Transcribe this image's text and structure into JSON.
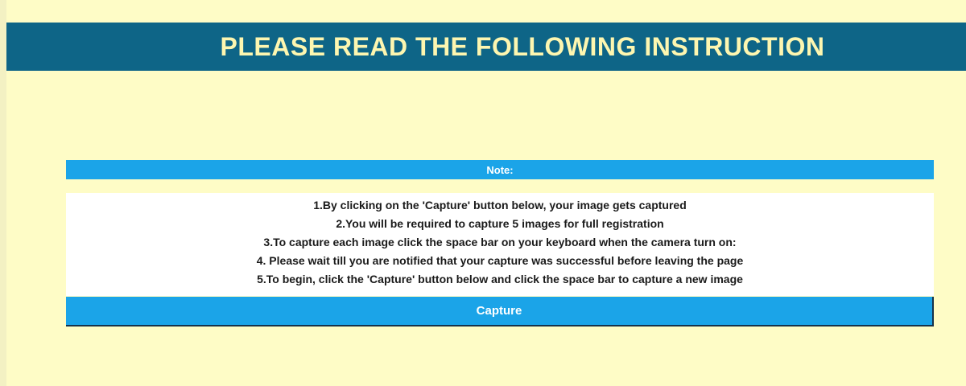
{
  "header": {
    "title": "PLEASE READ THE FOLLOWING INSTRUCTION"
  },
  "note": {
    "label": "Note:"
  },
  "instructions": [
    "1.By clicking on the 'Capture' button below, your image gets captured",
    "2.You will be required to capture 5 images for full registration",
    "3.To capture each image click the space bar on your keyboard when the camera turn on:",
    "4. Please wait till you are notified that your capture was successful before leaving the page",
    "5.To begin, click the 'Capture' button below and click the space bar to capture a new image"
  ],
  "capture_button": {
    "label": "Capture"
  },
  "colors": {
    "page_background": "#fefcc6",
    "header_background": "#0e6587",
    "header_text": "#fdf6b0",
    "accent_blue": "#1ba4e8",
    "instruction_background": "#ffffff"
  }
}
